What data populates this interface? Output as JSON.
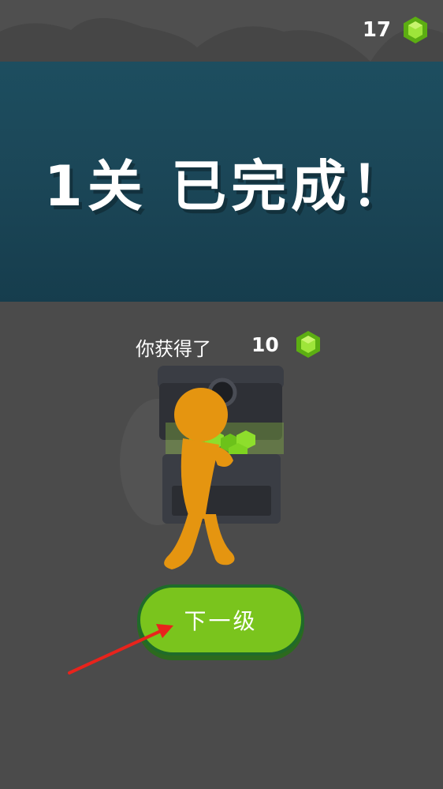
{
  "header": {
    "gem_count": "17",
    "gem_icon": "green-gem-icon"
  },
  "level": {
    "title": "1关 已完成！"
  },
  "reward": {
    "label": "你获得了",
    "amount": "10",
    "gem_icon": "green-gem-icon",
    "illustration": "orange-character-with-treasure-chest"
  },
  "next_button": {
    "label": "下一级"
  },
  "annotation": {
    "arrow_icon": "red-arrow-icon"
  },
  "colors": {
    "background": "#4b4b4b",
    "banner": "#1b4657",
    "button_fill": "#7ac41d",
    "button_border": "#1f6b2a",
    "gem": "#7ed321",
    "character": "#e59510",
    "arrow": "#e8231c"
  }
}
